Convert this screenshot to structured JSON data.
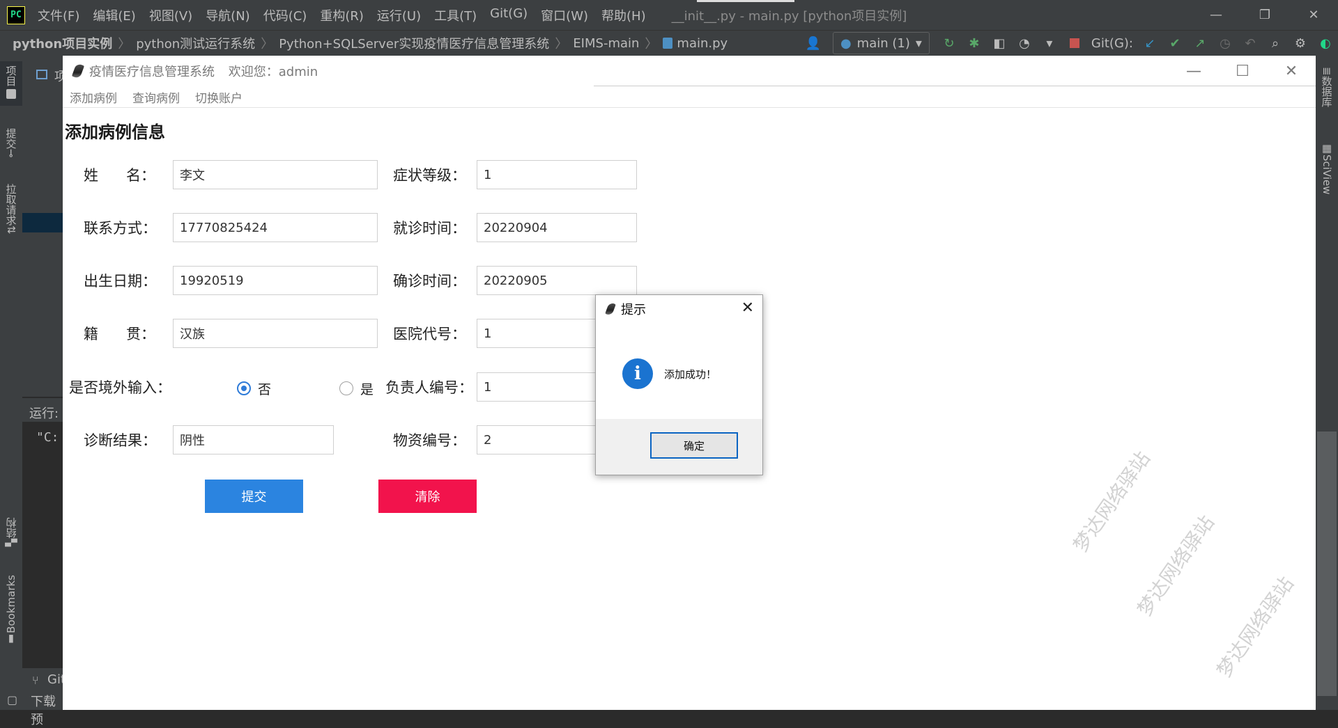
{
  "ide": {
    "logo": "PC",
    "menu": [
      "文件(F)",
      "编辑(E)",
      "视图(V)",
      "导航(N)",
      "代码(C)",
      "重构(R)",
      "运行(U)",
      "工具(T)",
      "Git(G)",
      "窗口(W)",
      "帮助(H)"
    ],
    "title": "__init__.py - main.py [python项目实例]",
    "window_controls": [
      "—",
      "❐",
      "✕"
    ],
    "breadcrumbs": [
      "python项目实例",
      "python测试运行系统",
      "Python+SQLServer实现疫情医疗信息管理系统",
      "EIMS-main",
      "main.py"
    ],
    "branch": "main (1)",
    "git_label": "Git(G):",
    "left_tabs": [
      "项目",
      "提交",
      "拉取请求",
      "结构",
      "Bookmarks"
    ],
    "right_tabs": [
      "数据库",
      "SciView"
    ],
    "project_tab": "项",
    "run_label": "运行:",
    "run_output": "\"C:",
    "bottom_items": [
      "Git",
      "下载预"
    ]
  },
  "app": {
    "title": "疫情医疗信息管理系统",
    "welcome": "欢迎您：admin",
    "window_controls": [
      "—",
      "☐",
      "✕"
    ],
    "menu": [
      "添加病例",
      "查询病例",
      "切换账户"
    ],
    "section_title": "添加病例信息",
    "form": {
      "name_label": "姓      名：",
      "name_value": "李文",
      "severity_label": "症状等级：",
      "severity_value": "1",
      "phone_label": "联系方式：",
      "phone_value": "17770825424",
      "visit_label": "就诊时间：",
      "visit_value": "20220904",
      "birth_label": "出生日期：",
      "birth_value": "19920519",
      "confirm_label": "确诊时间：",
      "confirm_value": "20220905",
      "origin_label": "籍      贯：",
      "origin_value": "汉族",
      "hospital_label": "医院代号：",
      "hospital_value": "1",
      "imported_label": "是否境外输入：",
      "radio_no": "否",
      "radio_yes": "是",
      "imported_selected": "否",
      "manager_label": "负责人编号：",
      "manager_value": "1",
      "diagnosis_label": "诊断结果：",
      "diagnosis_value": "阴性",
      "supply_label": "物资编号：",
      "supply_value": "2"
    },
    "submit_label": "提交",
    "clear_label": "清除",
    "watermark": "梦达网络驿站"
  },
  "dialog": {
    "title": "提示",
    "close": "✕",
    "icon": "i",
    "message": "添加成功！",
    "ok_label": "确定"
  },
  "colors": {
    "submit": "#2b84e0",
    "clear": "#f2134c",
    "info_icon": "#1a73d0",
    "ide_bg": "#3c3f41"
  }
}
